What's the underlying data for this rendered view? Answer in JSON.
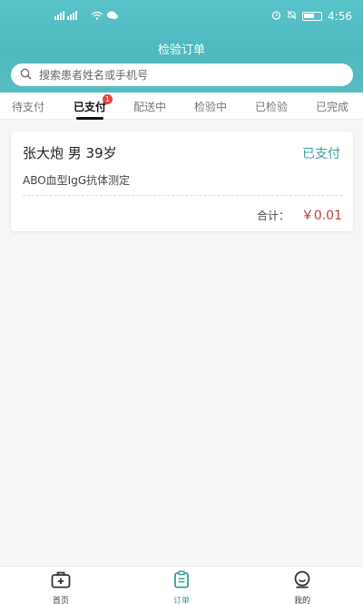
{
  "status_bar": {
    "time": "4:56"
  },
  "header": {
    "title": "检验订单"
  },
  "search": {
    "placeholder": "搜索患者姓名或手机号"
  },
  "tabs": [
    {
      "label": "待支付"
    },
    {
      "label": "已支付",
      "badge": "1",
      "active": true
    },
    {
      "label": "配送中"
    },
    {
      "label": "检验中"
    },
    {
      "label": "已检验"
    },
    {
      "label": "已完成"
    }
  ],
  "orders": [
    {
      "patient": "张大炮 男 39岁",
      "status": "已支付",
      "test": "ABO血型IgG抗体测定",
      "total_label": "合计：",
      "total_amount": "￥0.01"
    }
  ],
  "bottom_nav": [
    {
      "label": "首页",
      "icon": "medkit-icon"
    },
    {
      "label": "订单",
      "icon": "clipboard-icon",
      "active": true
    },
    {
      "label": "我的",
      "icon": "profile-icon"
    }
  ],
  "colors": {
    "accent": "#3a9f9a",
    "header": "#58c3c9",
    "price": "#c23b3b",
    "badge": "#e0453b"
  }
}
